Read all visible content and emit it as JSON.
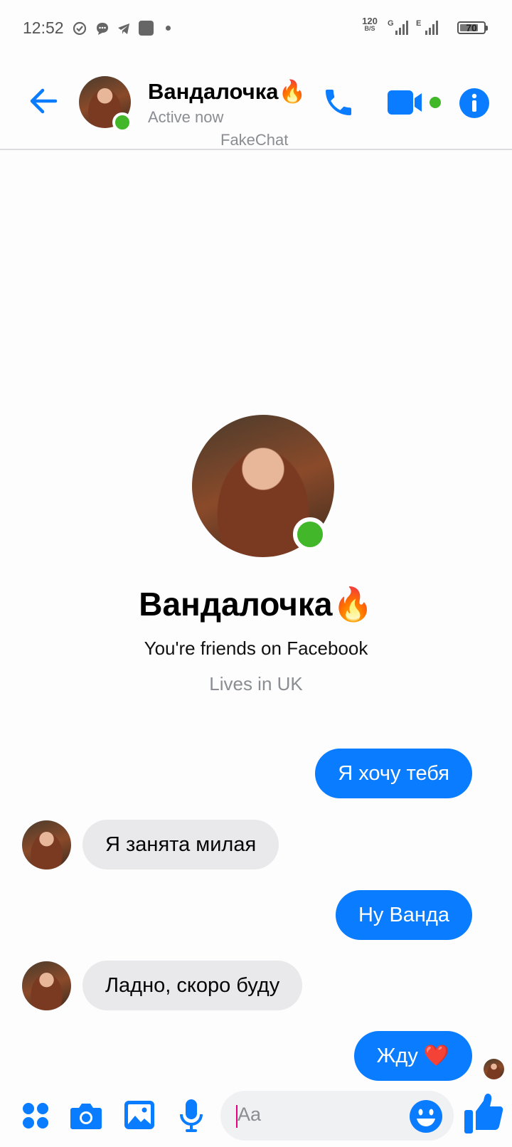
{
  "status_bar": {
    "time": "12:52",
    "speed_top": "120",
    "speed_bottom": "B/S",
    "net1": "G",
    "net2": "E",
    "battery": "70"
  },
  "header": {
    "name": "Вандалочка🔥",
    "status": "Active now",
    "watermark": "FakeChat"
  },
  "profile": {
    "name": "Вандалочка🔥",
    "line1": "You're friends on Facebook",
    "line2": "Lives in UK"
  },
  "messages": [
    {
      "side": "out",
      "text": "Я хочу тебя"
    },
    {
      "side": "in",
      "text": "Я занята милая"
    },
    {
      "side": "out",
      "text": "Ну Ванда"
    },
    {
      "side": "in",
      "text": "Ладно, скоро буду"
    },
    {
      "side": "out",
      "text": "Жду ❤️"
    }
  ],
  "composer": {
    "placeholder": "Aa"
  },
  "colors": {
    "accent": "#0a7cff",
    "online": "#42b72a",
    "incoming_bubble": "#e9e9eb"
  },
  "icons": [
    "back-arrow-icon",
    "phone-icon",
    "video-camera-icon",
    "info-icon",
    "apps-icon",
    "camera-icon",
    "gallery-icon",
    "microphone-icon",
    "emoji-icon",
    "thumbs-up-icon"
  ]
}
